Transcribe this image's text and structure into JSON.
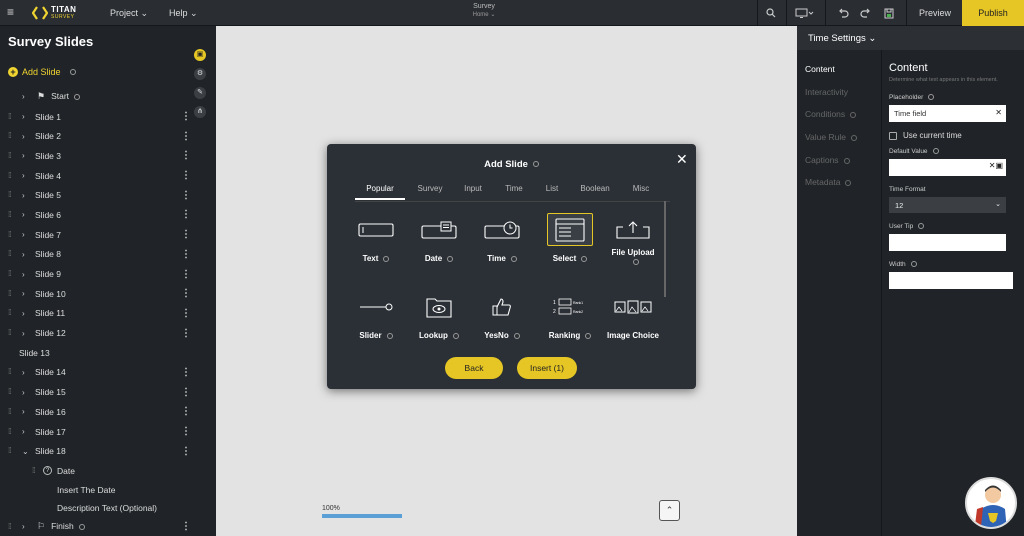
{
  "app": {
    "logo_title": "TITAN",
    "logo_sub": "SURVEY",
    "menu_project": "Project",
    "menu_help": "Help",
    "doc_title": "Survey",
    "doc_page": "Home",
    "preview_label": "Preview",
    "publish_label": "Publish",
    "accent_color": "#e6c624"
  },
  "sidebar": {
    "title": "Survey Slides",
    "add_label": "Add Slide",
    "items": [
      {
        "label": "Start",
        "type": "start"
      },
      {
        "label": "Slide 1"
      },
      {
        "label": "Slide 2"
      },
      {
        "label": "Slide 3"
      },
      {
        "label": "Slide 4"
      },
      {
        "label": "Slide 5"
      },
      {
        "label": "Slide 6"
      },
      {
        "label": "Slide 7"
      },
      {
        "label": "Slide 8"
      },
      {
        "label": "Slide 9"
      },
      {
        "label": "Slide 10"
      },
      {
        "label": "Slide 11"
      },
      {
        "label": "Slide 12"
      },
      {
        "label": "Slide 13",
        "type": "plain"
      },
      {
        "label": "Slide 14"
      },
      {
        "label": "Slide 15"
      },
      {
        "label": "Slide 16"
      },
      {
        "label": "Slide 17"
      },
      {
        "label": "Slide 18",
        "type": "expanded"
      },
      {
        "label": "Date",
        "type": "child"
      },
      {
        "label": "Insert The Date",
        "type": "grandchild"
      },
      {
        "label": "Description Text (Optional)",
        "type": "grandchild"
      },
      {
        "label": "Finish",
        "type": "finish"
      }
    ]
  },
  "canvas": {
    "progress_label": "100%",
    "progress_fraction": 1.0
  },
  "modal": {
    "title": "Add Slide",
    "tabs": [
      "Popular",
      "Survey",
      "Input",
      "Time",
      "List",
      "Boolean",
      "Misc"
    ],
    "active_tab": "Popular",
    "tiles": [
      {
        "label": "Text",
        "icon": "text-field-icon"
      },
      {
        "label": "Date",
        "icon": "calendar-field-icon"
      },
      {
        "label": "Time",
        "icon": "clock-field-icon"
      },
      {
        "label": "Select",
        "icon": "select-list-icon",
        "selected": true
      },
      {
        "label": "File Upload",
        "icon": "upload-icon"
      },
      {
        "label": "Slider",
        "icon": "slider-icon"
      },
      {
        "label": "Lookup",
        "icon": "folder-eye-icon"
      },
      {
        "label": "YesNo",
        "icon": "thumbs-up-icon"
      },
      {
        "label": "Ranking",
        "icon": "ranking-icon"
      },
      {
        "label": "Image Choice",
        "icon": "image-choice-icon"
      }
    ],
    "ranking_icon_text": [
      "1",
      "2",
      "Rank1",
      "Rank2"
    ],
    "back_label": "Back",
    "insert_label": "Insert (1)"
  },
  "right_panel": {
    "header": "Time Settings",
    "nav": [
      "Content",
      "Interactivity",
      "Conditions",
      "Value Rule",
      "Captions",
      "Metadata"
    ],
    "active_nav": "Content",
    "content_title": "Content",
    "content_desc": "Determine what text appears in this element.",
    "placeholder_label": "Placeholder",
    "placeholder_value": "Time field",
    "use_current_time_label": "Use current time",
    "default_value_label": "Default Value",
    "time_format_label": "Time Format",
    "time_format_value": "12",
    "user_tip_label": "User Tip",
    "width_label": "Width"
  }
}
